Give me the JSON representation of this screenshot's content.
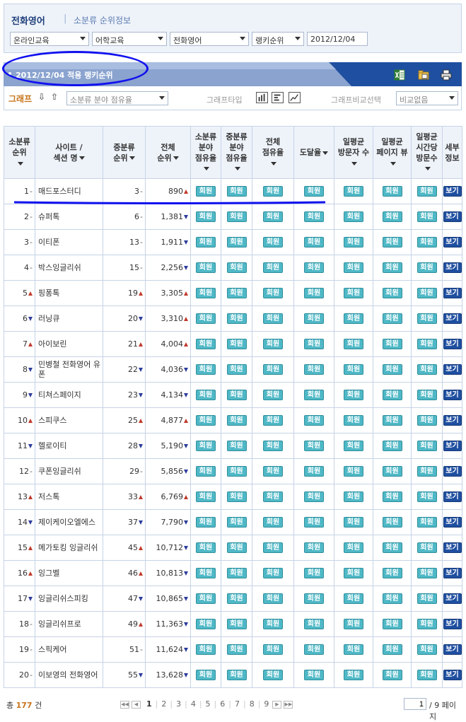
{
  "top": {
    "title": "전화영어",
    "separator": "|",
    "subtitle": "소분류 순위정보",
    "filters": [
      "온라인교육",
      "어학교육",
      "전화영어",
      "랭키순위",
      "2012/12/04"
    ]
  },
  "band": {
    "title": "2012/12/04 적용 랭키순위",
    "icons": [
      "excel-icon",
      "folder-save-icon",
      "print-icon"
    ]
  },
  "graph": {
    "label": "그래프",
    "down_arrow": "⇩",
    "up_arrow": "⇧",
    "select_value": "소분류 분야 점유율",
    "type_label": "그래프타입",
    "compare_label": "그래프비교선택",
    "compare_value": "비교없음"
  },
  "table": {
    "headers": [
      [
        "소분류",
        "순위"
      ],
      [
        "사이트 /",
        "섹션 명"
      ],
      [
        "중분류",
        "순위"
      ],
      [
        "전체",
        "순위"
      ],
      [
        "소분류",
        "분야",
        "점유율"
      ],
      [
        "중분류",
        "분야",
        "점유율"
      ],
      [
        "전체",
        "점유율"
      ],
      [
        "도달율"
      ],
      [
        "일평균",
        "방문자 수"
      ],
      [
        "일평균",
        "페이지 뷰"
      ],
      [
        "일평균",
        "시간당",
        "방문수"
      ],
      [
        "세부",
        "정보"
      ]
    ],
    "member_label": "회원",
    "view_label": "보기",
    "rows": [
      {
        "rank": "1",
        "rank_t": "same",
        "site": "매드포스터디",
        "mid": "3",
        "mid_t": "same",
        "total": "890",
        "total_t": "up"
      },
      {
        "rank": "2",
        "rank_t": "same",
        "site": "슈퍼톡",
        "mid": "6",
        "mid_t": "same",
        "total": "1,381",
        "total_t": "down"
      },
      {
        "rank": "3",
        "rank_t": "same",
        "site": "이티폰",
        "mid": "13",
        "mid_t": "same",
        "total": "1,911",
        "total_t": "down"
      },
      {
        "rank": "4",
        "rank_t": "same",
        "site": "박스잉글리쉬",
        "mid": "15",
        "mid_t": "same",
        "total": "2,256",
        "total_t": "down"
      },
      {
        "rank": "5",
        "rank_t": "up",
        "site": "핑퐁톡",
        "mid": "19",
        "mid_t": "up",
        "total": "3,305",
        "total_t": "up"
      },
      {
        "rank": "6",
        "rank_t": "down",
        "site": "러닝큐",
        "mid": "20",
        "mid_t": "down",
        "total": "3,310",
        "total_t": "up"
      },
      {
        "rank": "7",
        "rank_t": "up",
        "site": "아이보린",
        "mid": "21",
        "mid_t": "up",
        "total": "4,004",
        "total_t": "up"
      },
      {
        "rank": "8",
        "rank_t": "down",
        "site": "민병철 전화영어 유폰",
        "mid": "22",
        "mid_t": "down",
        "total": "4,036",
        "total_t": "down"
      },
      {
        "rank": "9",
        "rank_t": "down",
        "site": "티쳐스페이지",
        "mid": "23",
        "mid_t": "down",
        "total": "4,134",
        "total_t": "down"
      },
      {
        "rank": "10",
        "rank_t": "up",
        "site": "스피쿠스",
        "mid": "25",
        "mid_t": "up",
        "total": "4,877",
        "total_t": "up"
      },
      {
        "rank": "11",
        "rank_t": "down",
        "site": "헬로이티",
        "mid": "28",
        "mid_t": "down",
        "total": "5,190",
        "total_t": "down"
      },
      {
        "rank": "12",
        "rank_t": "same",
        "site": "쿠폰잉글리쉬",
        "mid": "29",
        "mid_t": "same",
        "total": "5,856",
        "total_t": "down"
      },
      {
        "rank": "13",
        "rank_t": "up",
        "site": "저스톡",
        "mid": "33",
        "mid_t": "up",
        "total": "6,769",
        "total_t": "up"
      },
      {
        "rank": "14",
        "rank_t": "down",
        "site": "제이케이오엘에스",
        "mid": "37",
        "mid_t": "down",
        "total": "7,790",
        "total_t": "down"
      },
      {
        "rank": "15",
        "rank_t": "up",
        "site": "메가토킹 잉글리쉬",
        "mid": "45",
        "mid_t": "up",
        "total": "10,712",
        "total_t": "down"
      },
      {
        "rank": "16",
        "rank_t": "up",
        "site": "잉그벨",
        "mid": "46",
        "mid_t": "up",
        "total": "10,813",
        "total_t": "down"
      },
      {
        "rank": "17",
        "rank_t": "down",
        "site": "잉글리쉬스피킹",
        "mid": "47",
        "mid_t": "down",
        "total": "10,865",
        "total_t": "down"
      },
      {
        "rank": "18",
        "rank_t": "same",
        "site": "잉글리쉬프로",
        "mid": "49",
        "mid_t": "up",
        "total": "11,363",
        "total_t": "down"
      },
      {
        "rank": "19",
        "rank_t": "same",
        "site": "스픽케어",
        "mid": "51",
        "mid_t": "same",
        "total": "11,624",
        "total_t": "down"
      },
      {
        "rank": "20",
        "rank_t": "same",
        "site": "이보영의 전화영어",
        "mid": "55",
        "mid_t": "down",
        "total": "13,628",
        "total_t": "down"
      }
    ]
  },
  "footer": {
    "total_prefix": "총",
    "total_count": "177",
    "total_suffix": "건",
    "pages": [
      "1",
      "2",
      "3",
      "4",
      "5",
      "6",
      "7",
      "8",
      "9"
    ],
    "current_page": "1",
    "page_input": "1",
    "page_total": "/ 9 페이지"
  },
  "colors": {
    "accent_blue": "#1f4fa0",
    "member_button": "#4fb8c6",
    "up": "#c0392b",
    "down": "#2c3c9a",
    "annotation": "#1111ee"
  }
}
